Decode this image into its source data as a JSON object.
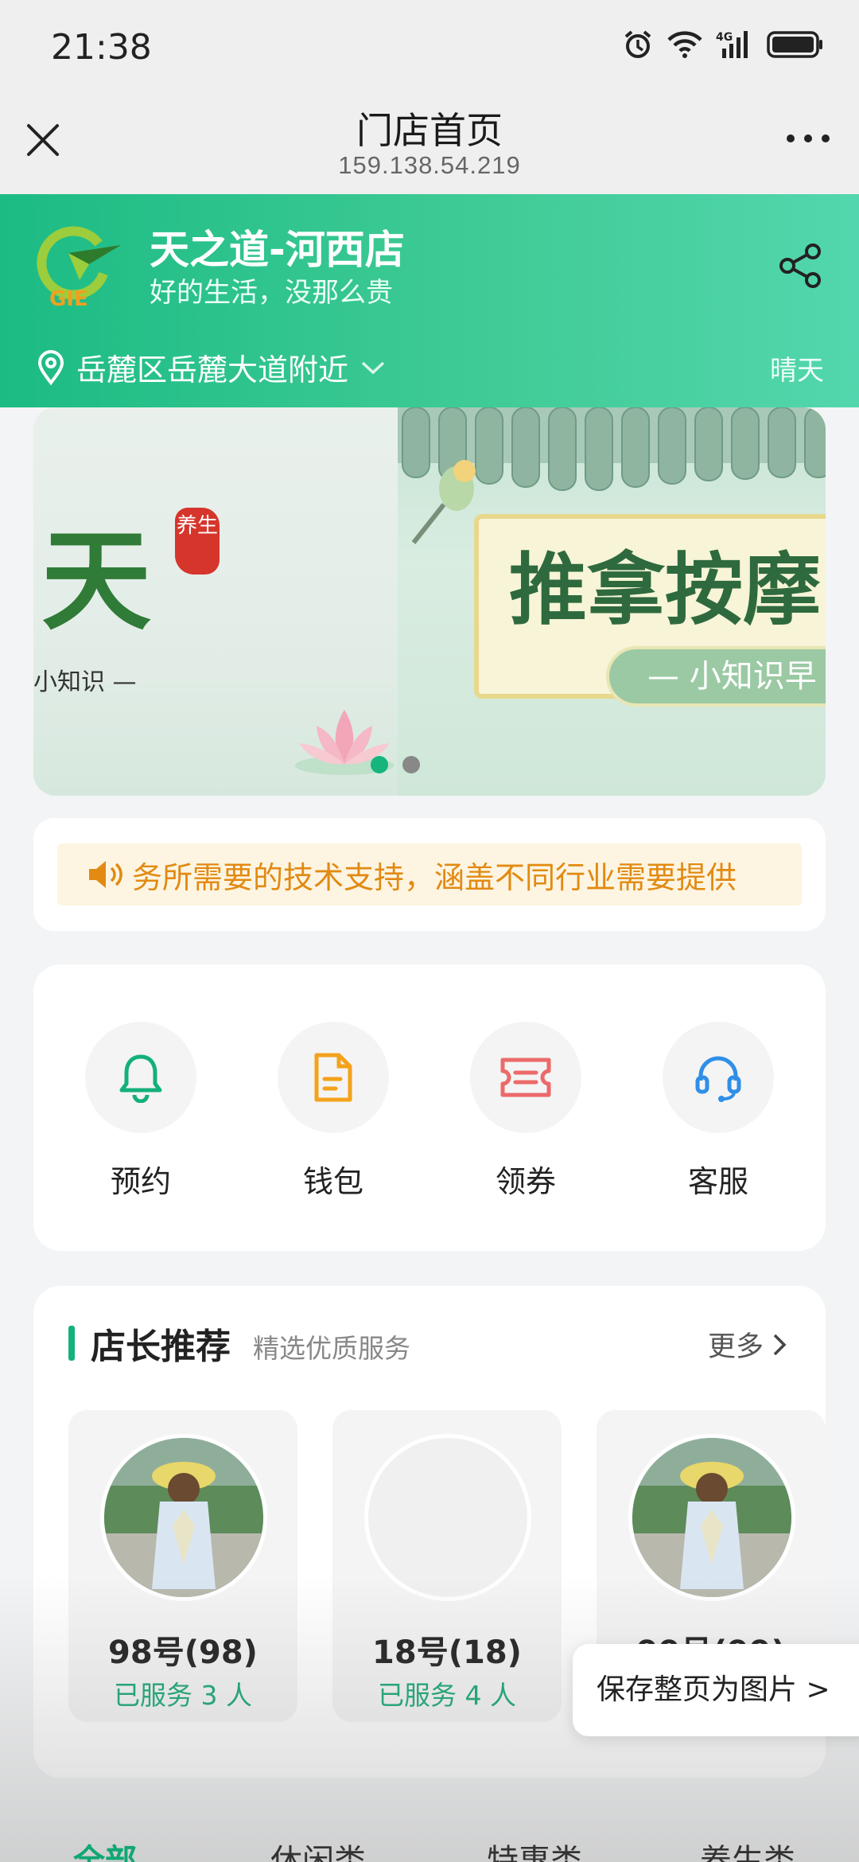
{
  "status_bar": {
    "time": "21:38",
    "icons": [
      "alarm-icon",
      "wifi-icon",
      "4g-signal-icon",
      "battery-icon"
    ]
  },
  "titlebar": {
    "title": "门店首页",
    "subtitle": "159.138.54.219"
  },
  "store": {
    "name": "天之道-河西店",
    "slogan": "好的生活，没那么贵",
    "location": "岳麓区岳麓大道附近",
    "weather": "晴天",
    "logo_text": "GIE"
  },
  "banner": {
    "slide1": {
      "big_text": "天",
      "seal_text": "养生",
      "sub_text": "小知识 —"
    },
    "slide2": {
      "title": "推拿按摩",
      "pill_text": "— 小知识早"
    },
    "dot_count": 2,
    "active_dot": 0
  },
  "notice": {
    "text": "务所需要的技术支持，涵盖不同行业需要提供"
  },
  "actions": [
    {
      "label": "预约",
      "icon": "bell-icon"
    },
    {
      "label": "钱包",
      "icon": "document-icon"
    },
    {
      "label": "领券",
      "icon": "ticket-icon"
    },
    {
      "label": "客服",
      "icon": "headset-icon"
    }
  ],
  "recommend": {
    "title": "店长推荐",
    "subtitle": "精选优质服务",
    "more": "更多",
    "staff": [
      {
        "name": "98号(98)",
        "served": "已服务 3 人",
        "has_photo": true
      },
      {
        "name": "18号(18)",
        "served": "已服务 4 人",
        "has_photo": false
      },
      {
        "name": "99号(99)",
        "served": "",
        "has_photo": true
      }
    ]
  },
  "save_button": "保存整页为图片 >",
  "tabs": [
    "全部",
    "休闲类",
    "特惠类",
    "养生类"
  ],
  "colors": {
    "brand_green": "#1cbb84",
    "notice_orange": "#e28a12",
    "served_green": "#18a873"
  }
}
